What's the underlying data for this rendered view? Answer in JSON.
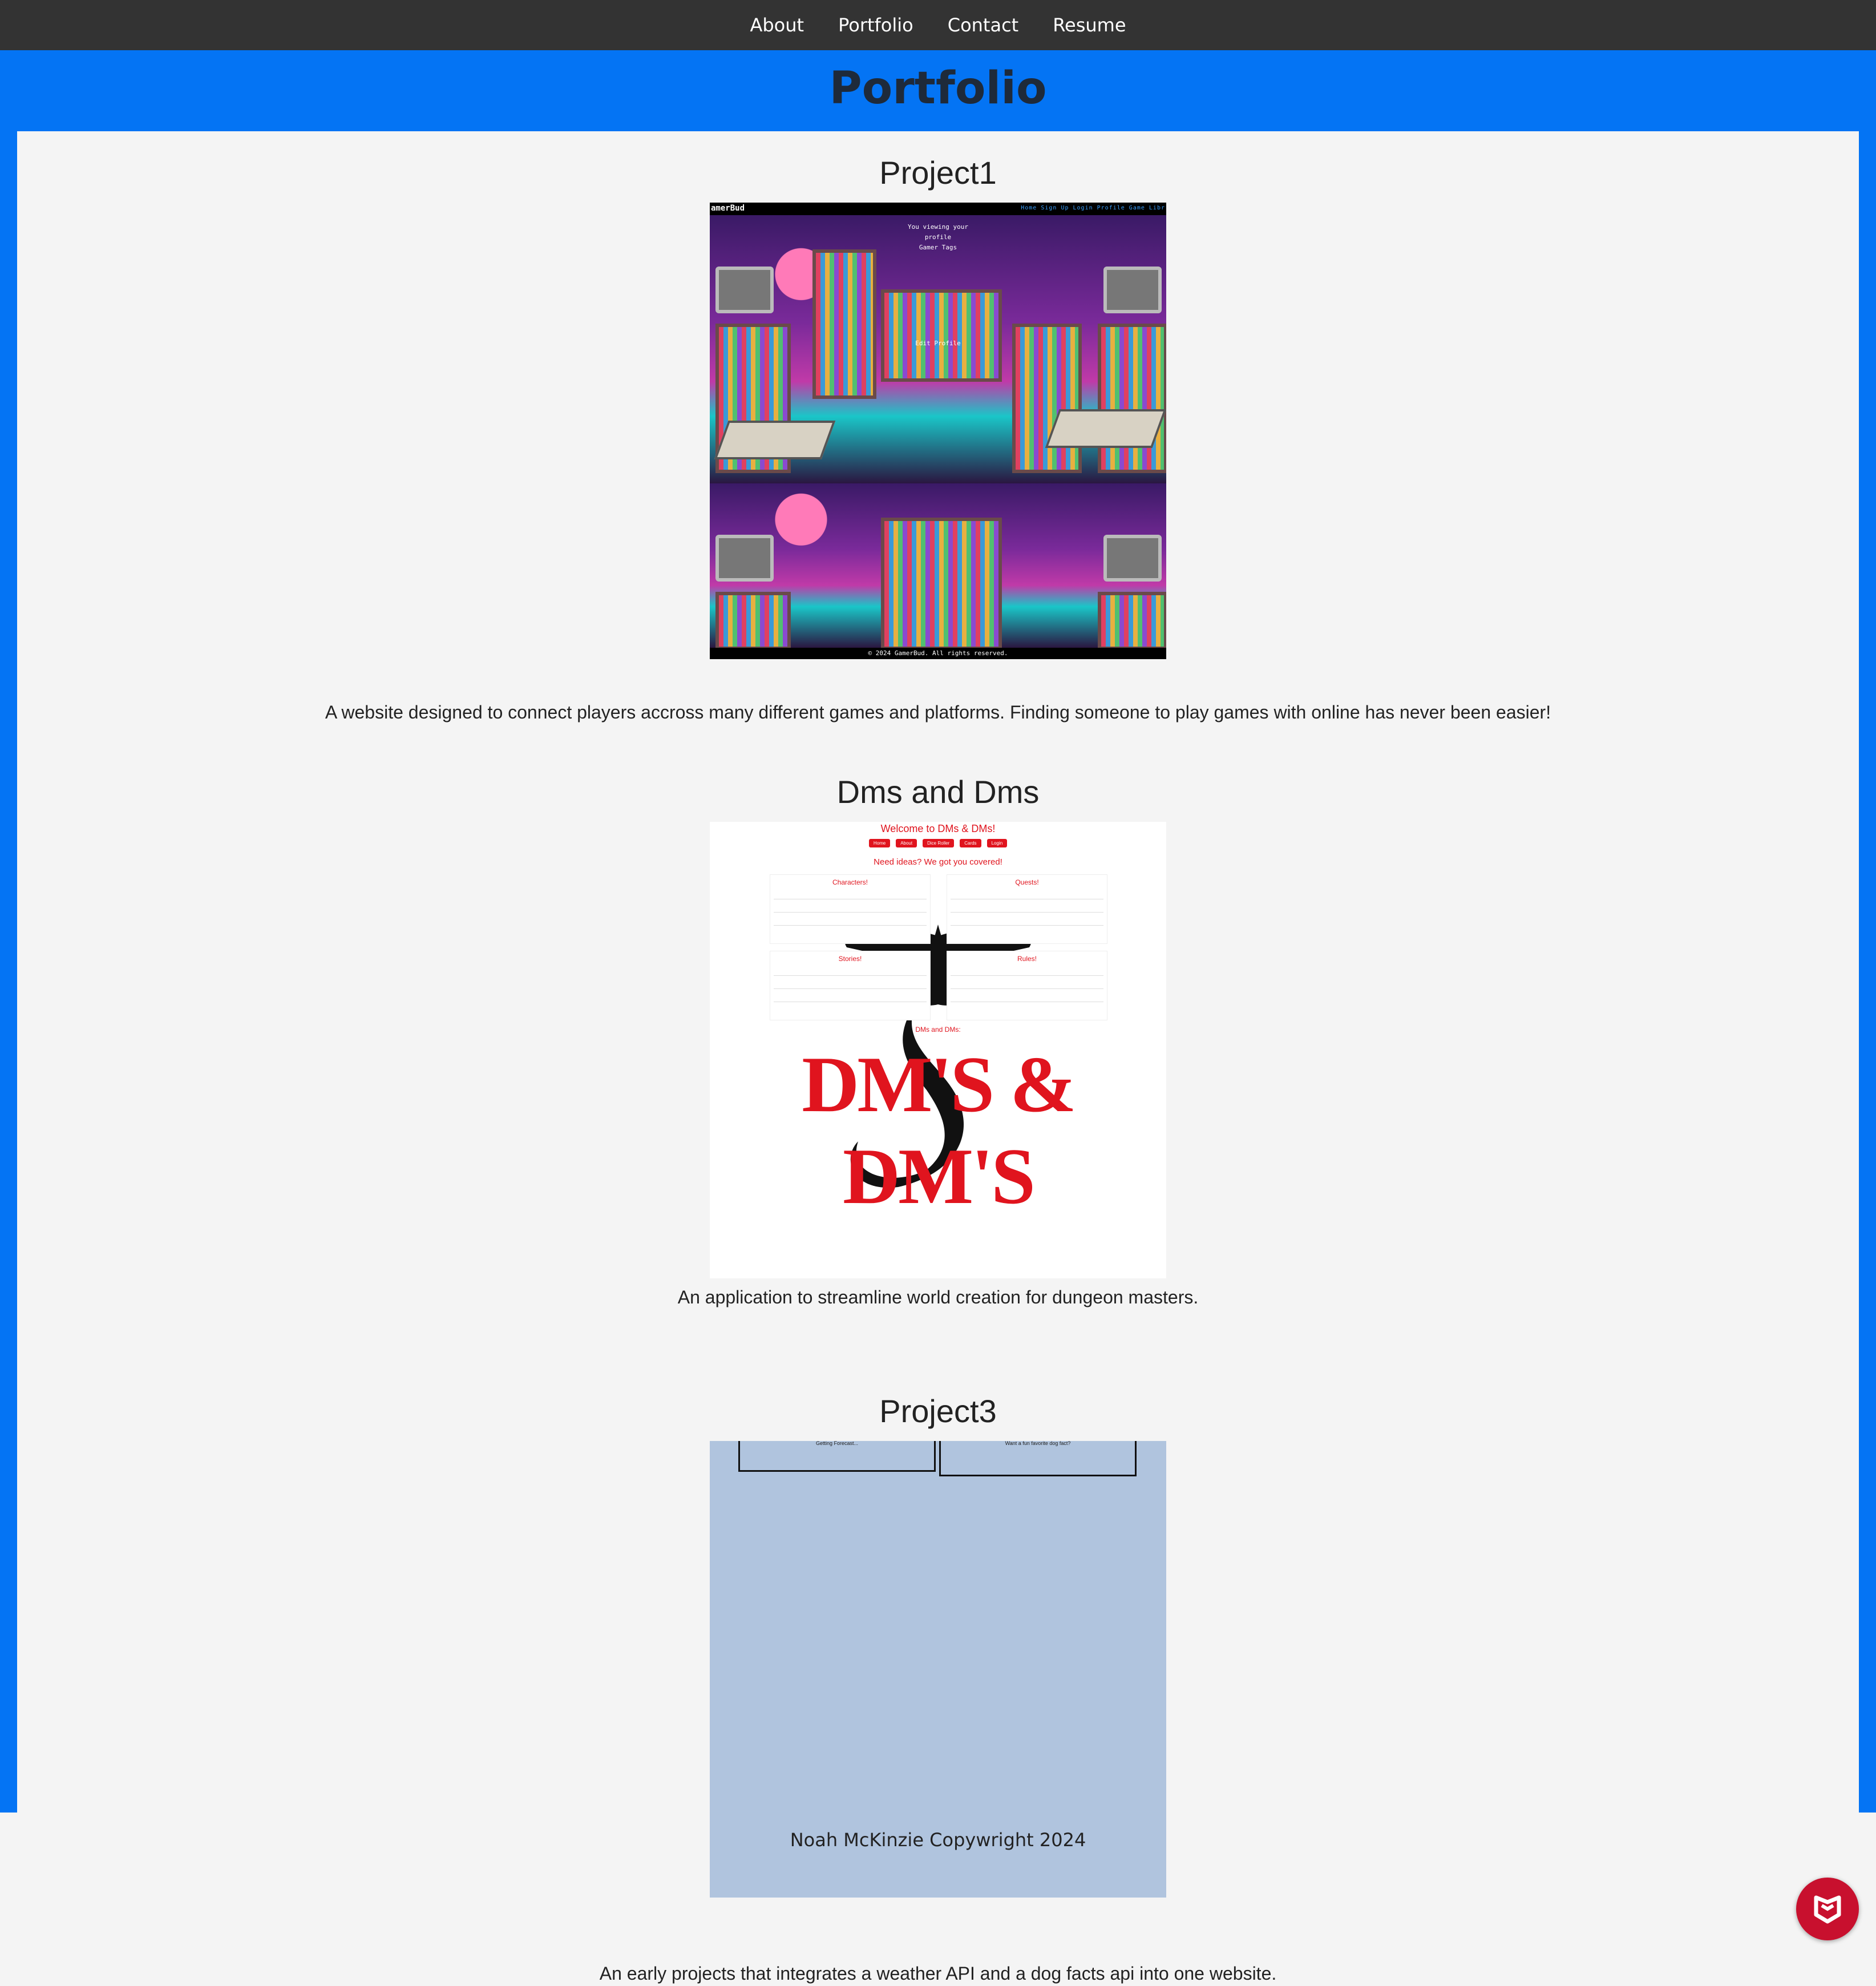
{
  "nav": {
    "items": [
      {
        "label": "About"
      },
      {
        "label": "Portfolio"
      },
      {
        "label": "Contact"
      },
      {
        "label": "Resume"
      }
    ]
  },
  "page": {
    "title": "Portfolio"
  },
  "projects": [
    {
      "title": "Project1",
      "description": "A website designed to connect players accross many different games and platforms. Finding someone to play games with online has never been easier!",
      "screenshot": {
        "brand": "amerBud",
        "links": "Home  Sign Up  Login  Profile  Game Libr",
        "menu": [
          "You viewing your profile",
          "Gamer Tags",
          "Edit Profile"
        ],
        "footer": "© 2024 GamerBud. All rights reserved."
      }
    },
    {
      "title": "Dms and Dms",
      "description": "An application to streamline world creation for dungeon masters.",
      "screenshot": {
        "heading": "Welcome to DMs & DMs!",
        "buttons": [
          "Home",
          "About",
          "Dice Roller",
          "Cards",
          "Login"
        ],
        "subheading": "Need ideas? We got you covered!",
        "boxes": [
          "Characters!",
          "Quests!",
          "Stories!",
          "Rules!"
        ],
        "credits": "DMs and DMs:",
        "logo": "DM'S & DM'S"
      }
    },
    {
      "title": "Project3",
      "description": "An early projects that integrates a weather API and a dog facts api into one website.",
      "screenshot": {
        "card_left": "Getting Forecast...",
        "card_right": "Want a fun favorite dog fact?",
        "footer": "Noah McKinzie Copywright 2024"
      }
    }
  ],
  "colors": {
    "nav_bg": "#333333",
    "accent_blue": "#0474f4",
    "content_bg": "#f4f4f4",
    "dms_red": "#e0141e",
    "weather_bg": "#b0c4de",
    "shield_red": "#c8102e"
  },
  "icons": {
    "floating": "security-shield-icon"
  }
}
